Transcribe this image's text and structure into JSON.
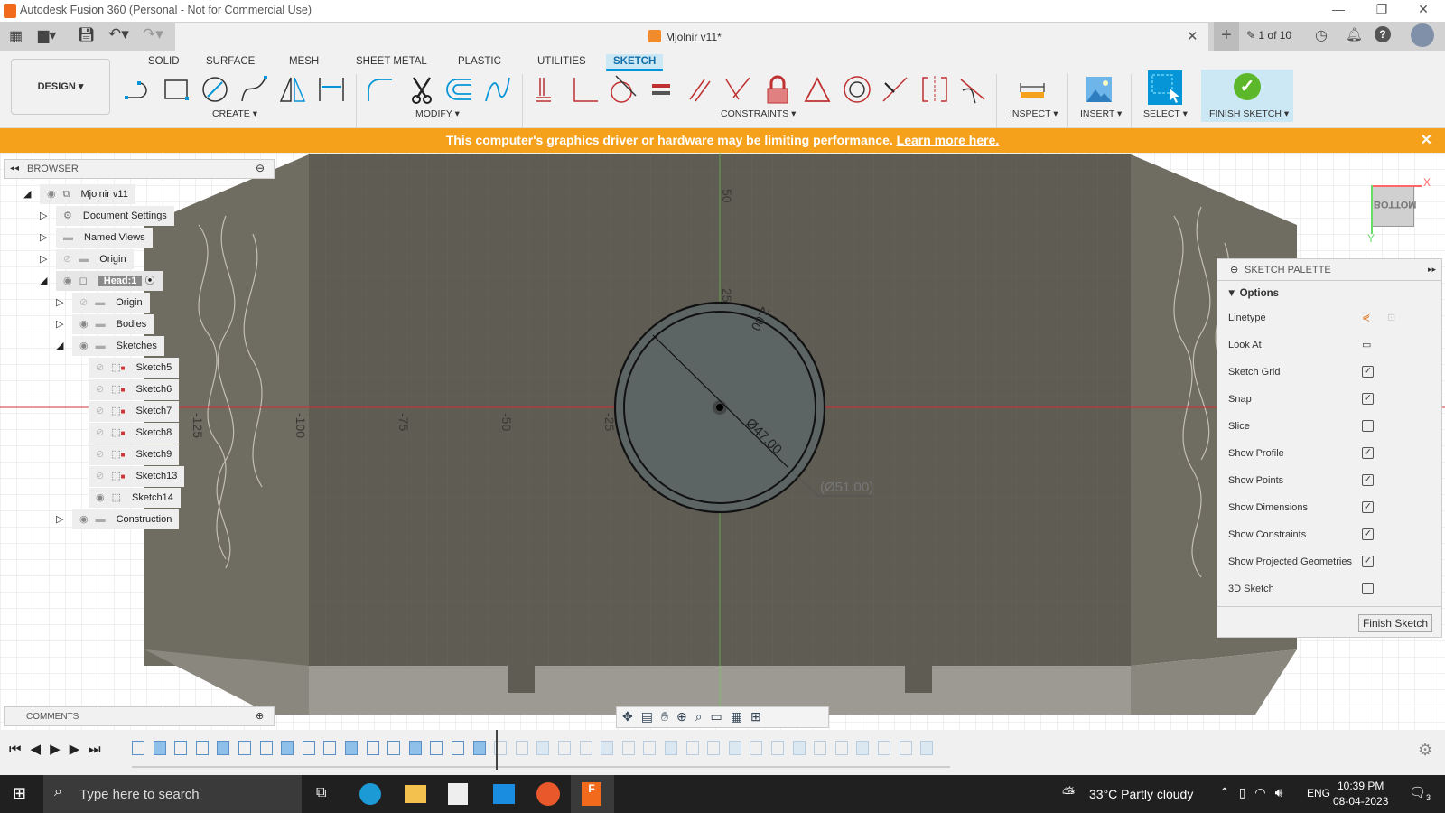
{
  "window": {
    "title": "Autodesk Fusion 360 (Personal - Not for Commercial Use)"
  },
  "doc_tab": {
    "title": "Mjolnir v11*",
    "page_count": "1 of 10"
  },
  "workspace": {
    "label": "DESIGN"
  },
  "ribbon_tabs": [
    "SOLID",
    "SURFACE",
    "MESH",
    "SHEET METAL",
    "PLASTIC",
    "UTILITIES",
    "SKETCH"
  ],
  "active_tab": "SKETCH",
  "groups": {
    "create": "CREATE",
    "modify": "MODIFY",
    "constraints": "CONSTRAINTS",
    "inspect": "INSPECT",
    "insert": "INSERT",
    "select": "SELECT",
    "finish": "FINISH SKETCH"
  },
  "banner": {
    "text": "This computer's graphics driver or hardware may be limiting performance.",
    "link": "Learn more here."
  },
  "browser": {
    "title": "BROWSER",
    "items": [
      {
        "label": "Mjolnir v11",
        "level": 0,
        "icon": "component-icon",
        "visible": true,
        "expanded": true
      },
      {
        "label": "Document Settings",
        "level": 1,
        "icon": "gear-icon",
        "expanded": false
      },
      {
        "label": "Named Views",
        "level": 1,
        "icon": "folder-icon",
        "expanded": false
      },
      {
        "label": "Origin",
        "level": 1,
        "icon": "folder-icon",
        "visible": false,
        "expanded": false
      },
      {
        "label": "Head:1",
        "level": 1,
        "icon": "body-icon",
        "visible": true,
        "expanded": true,
        "active": true
      },
      {
        "label": "Origin",
        "level": 2,
        "icon": "folder-icon",
        "visible": false,
        "expanded": false
      },
      {
        "label": "Bodies",
        "level": 2,
        "icon": "folder-icon",
        "visible": true,
        "expanded": false
      },
      {
        "label": "Sketches",
        "level": 2,
        "icon": "folder-icon",
        "visible": true,
        "expanded": true
      },
      {
        "label": "Sketch5",
        "level": 3,
        "icon": "sketch-icon",
        "visible": false
      },
      {
        "label": "Sketch6",
        "level": 3,
        "icon": "sketch-icon",
        "visible": false
      },
      {
        "label": "Sketch7",
        "level": 3,
        "icon": "sketch-icon",
        "visible": false
      },
      {
        "label": "Sketch8",
        "level": 3,
        "icon": "sketch-icon",
        "visible": false
      },
      {
        "label": "Sketch9",
        "level": 3,
        "icon": "sketch-icon",
        "visible": false
      },
      {
        "label": "Sketch13",
        "level": 3,
        "icon": "sketch-icon",
        "visible": false
      },
      {
        "label": "Sketch14",
        "level": 3,
        "icon": "sketch-edit-icon",
        "visible": true
      },
      {
        "label": "Construction",
        "level": 2,
        "icon": "folder-icon",
        "visible": true,
        "expanded": false
      }
    ]
  },
  "comments": {
    "title": "COMMENTS"
  },
  "viewport": {
    "ruler_labels": [
      "50",
      "25",
      "-125",
      "-100",
      "-75",
      "-50",
      "-25"
    ],
    "dim_inner": "Ø47.00",
    "dim_outer": "(Ø51.00)",
    "dim_offset": "2.00",
    "viewcube": "BOTTOM",
    "axis_x": "X",
    "axis_y": "Y"
  },
  "palette": {
    "title": "SKETCH PALETTE",
    "section": "Options",
    "linetype": "Linetype",
    "look_at": "Look At",
    "options": [
      {
        "label": "Sketch Grid",
        "checked": true
      },
      {
        "label": "Snap",
        "checked": true
      },
      {
        "label": "Slice",
        "checked": false
      },
      {
        "label": "Show Profile",
        "checked": true
      },
      {
        "label": "Show Points",
        "checked": true
      },
      {
        "label": "Show Dimensions",
        "checked": true
      },
      {
        "label": "Show Constraints",
        "checked": true
      },
      {
        "label": "Show Projected Geometries",
        "checked": true
      },
      {
        "label": "3D Sketch",
        "checked": false
      }
    ],
    "finish": "Finish Sketch"
  },
  "taskbar": {
    "search_placeholder": "Type here to search",
    "weather": "33°C  Partly cloudy",
    "lang": "ENG",
    "time": "10:39 PM",
    "date": "08-04-2023",
    "notifications": "3"
  }
}
